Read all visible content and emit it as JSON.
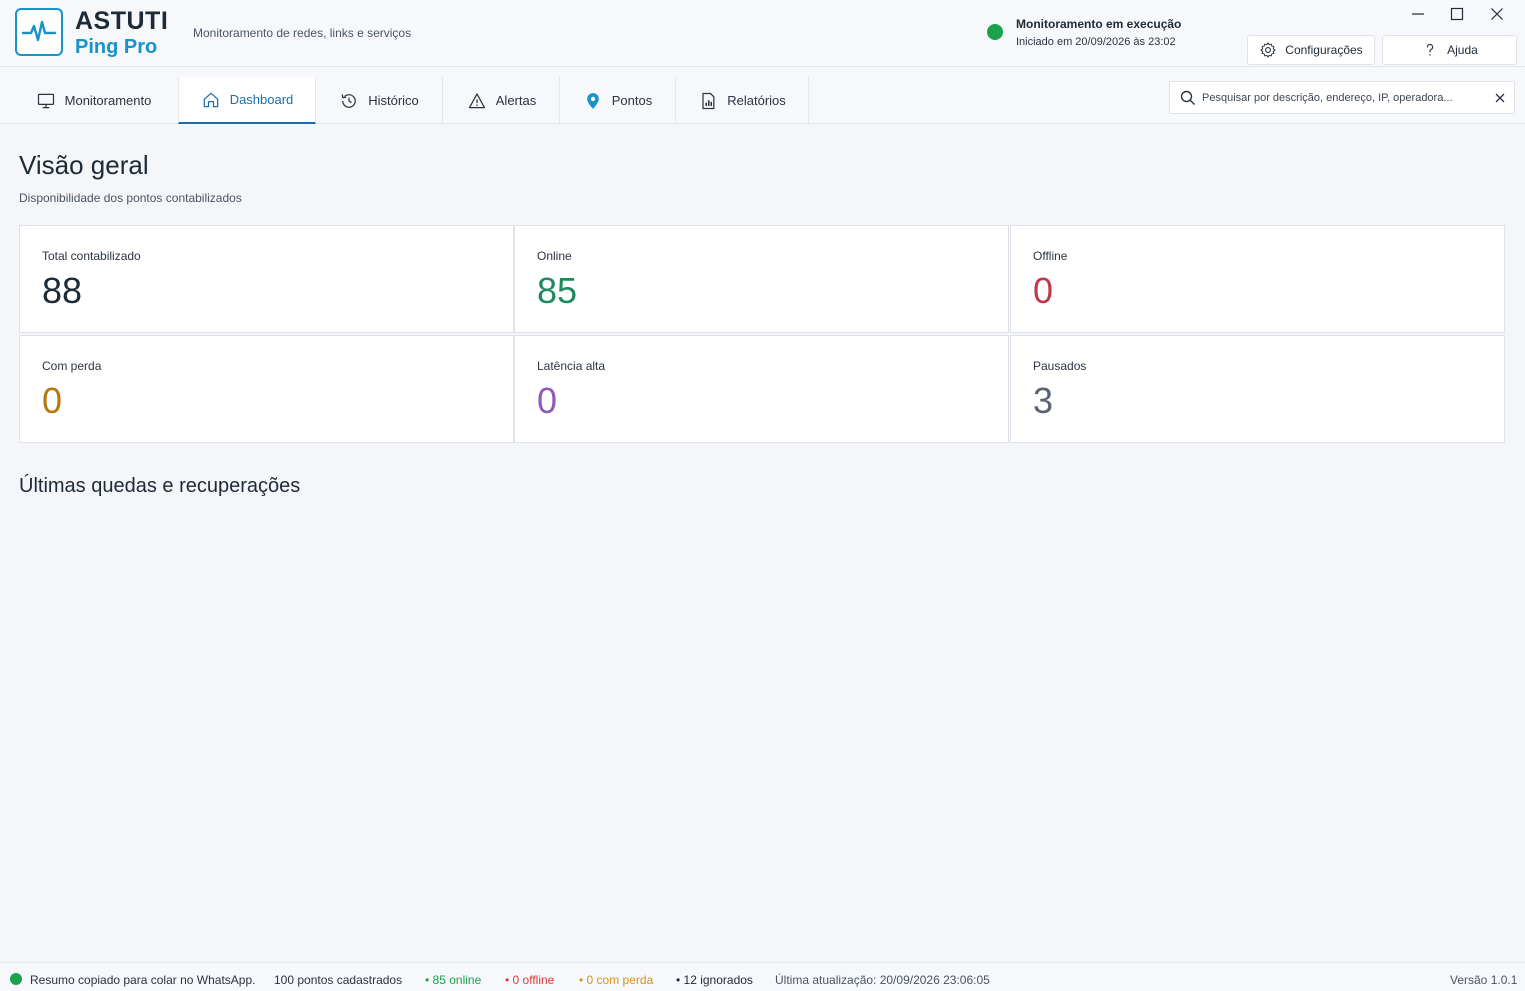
{
  "app": {
    "brand_top": "ASTUTI",
    "brand_bottom": "Ping Pro",
    "subtitle": "Monitoramento de redes, links e serviços",
    "accent_color": "#1793c9"
  },
  "status": {
    "title": "Monitoramento em execução",
    "started": "Iniciado em 20/09/2026 às 23:02",
    "color": "#1aa34a"
  },
  "buttons": {
    "config": "Configurações",
    "help": "Ajuda"
  },
  "tabs": [
    {
      "label": "Monitoramento",
      "icon": "monitor-icon"
    },
    {
      "label": "Dashboard",
      "icon": "home-icon",
      "active": true
    },
    {
      "label": "Histórico",
      "icon": "history-icon"
    },
    {
      "label": "Alertas",
      "icon": "warning-icon"
    },
    {
      "label": "Pontos",
      "icon": "location-pin-icon"
    },
    {
      "label": "Relatórios",
      "icon": "report-icon"
    }
  ],
  "search": {
    "placeholder": "Pesquisar por descrição, endereço, IP, operadora...",
    "value": ""
  },
  "overview": {
    "title": "Visão geral",
    "subtitle": "Disponibilidade dos pontos contabilizados",
    "cards": [
      {
        "label": "Total contabilizado",
        "value": "88",
        "color": "#1f2a37"
      },
      {
        "label": "Online",
        "value": "85",
        "color": "#1e8a5e"
      },
      {
        "label": "Offline",
        "value": "0",
        "color": "#c0394b"
      },
      {
        "label": "Com perda",
        "value": "0",
        "color": "#b7770f"
      },
      {
        "label": "Latência alta",
        "value": "0",
        "color": "#8e5cb8"
      },
      {
        "label": "Pausados",
        "value": "3",
        "color": "#5a6472"
      }
    ]
  },
  "recent": {
    "title": "Últimas quedas e recuperações"
  },
  "statusbar": {
    "message": "Resumo copiado para colar no WhatsApp.",
    "count": "100 pontos cadastrados",
    "online": "• 85 online",
    "offline": "• 0 offline",
    "perda": "• 0 com perda",
    "ignored": "• 12 ignorados",
    "update": "Última atualização: 20/09/2026 23:06:05",
    "version": "Versão 1.0.1"
  }
}
